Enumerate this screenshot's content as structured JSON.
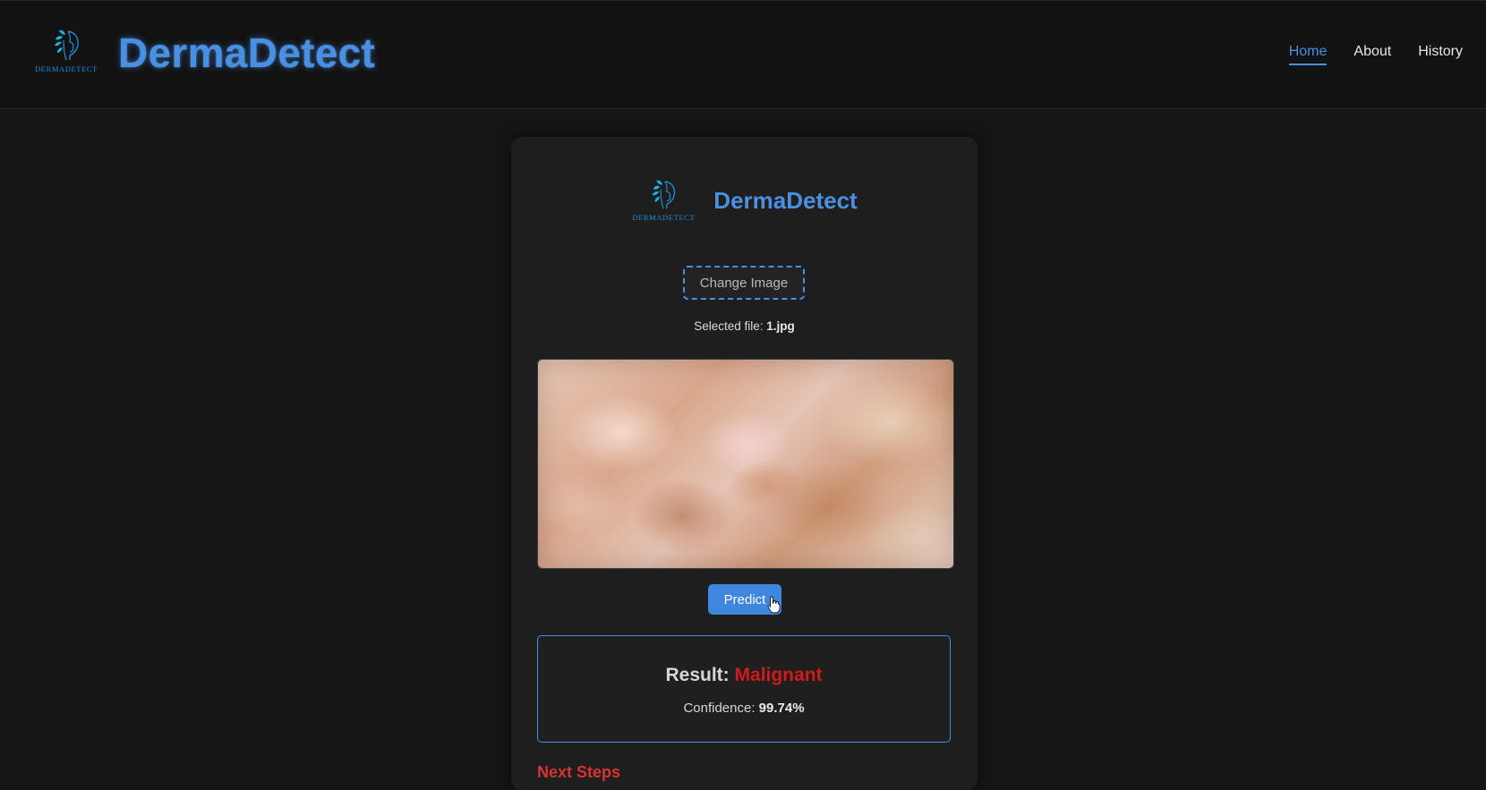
{
  "header": {
    "logo_wordmark": "DERMADETECT",
    "title": "DermaDetect",
    "nav": [
      {
        "label": "Home",
        "active": true
      },
      {
        "label": "About",
        "active": false
      },
      {
        "label": "History",
        "active": false
      }
    ]
  },
  "card": {
    "logo_wordmark": "DERMADETECT",
    "title": "DermaDetect",
    "change_image_label": "Change Image",
    "selected_file_prefix": "Selected file:",
    "selected_file_name": "1.jpg",
    "predict_label": "Predict",
    "result": {
      "label": "Result:",
      "value": "Malignant",
      "confidence_label": "Confidence:",
      "confidence_value": "99.74%"
    },
    "next_steps_heading": "Next Steps"
  },
  "colors": {
    "accent": "#4a90e2",
    "danger": "#d11a1a",
    "background": "#151515",
    "card": "#1e1e1e"
  },
  "icons": [
    "face-leaf-logo-icon",
    "hand-pointer-cursor-icon"
  ]
}
